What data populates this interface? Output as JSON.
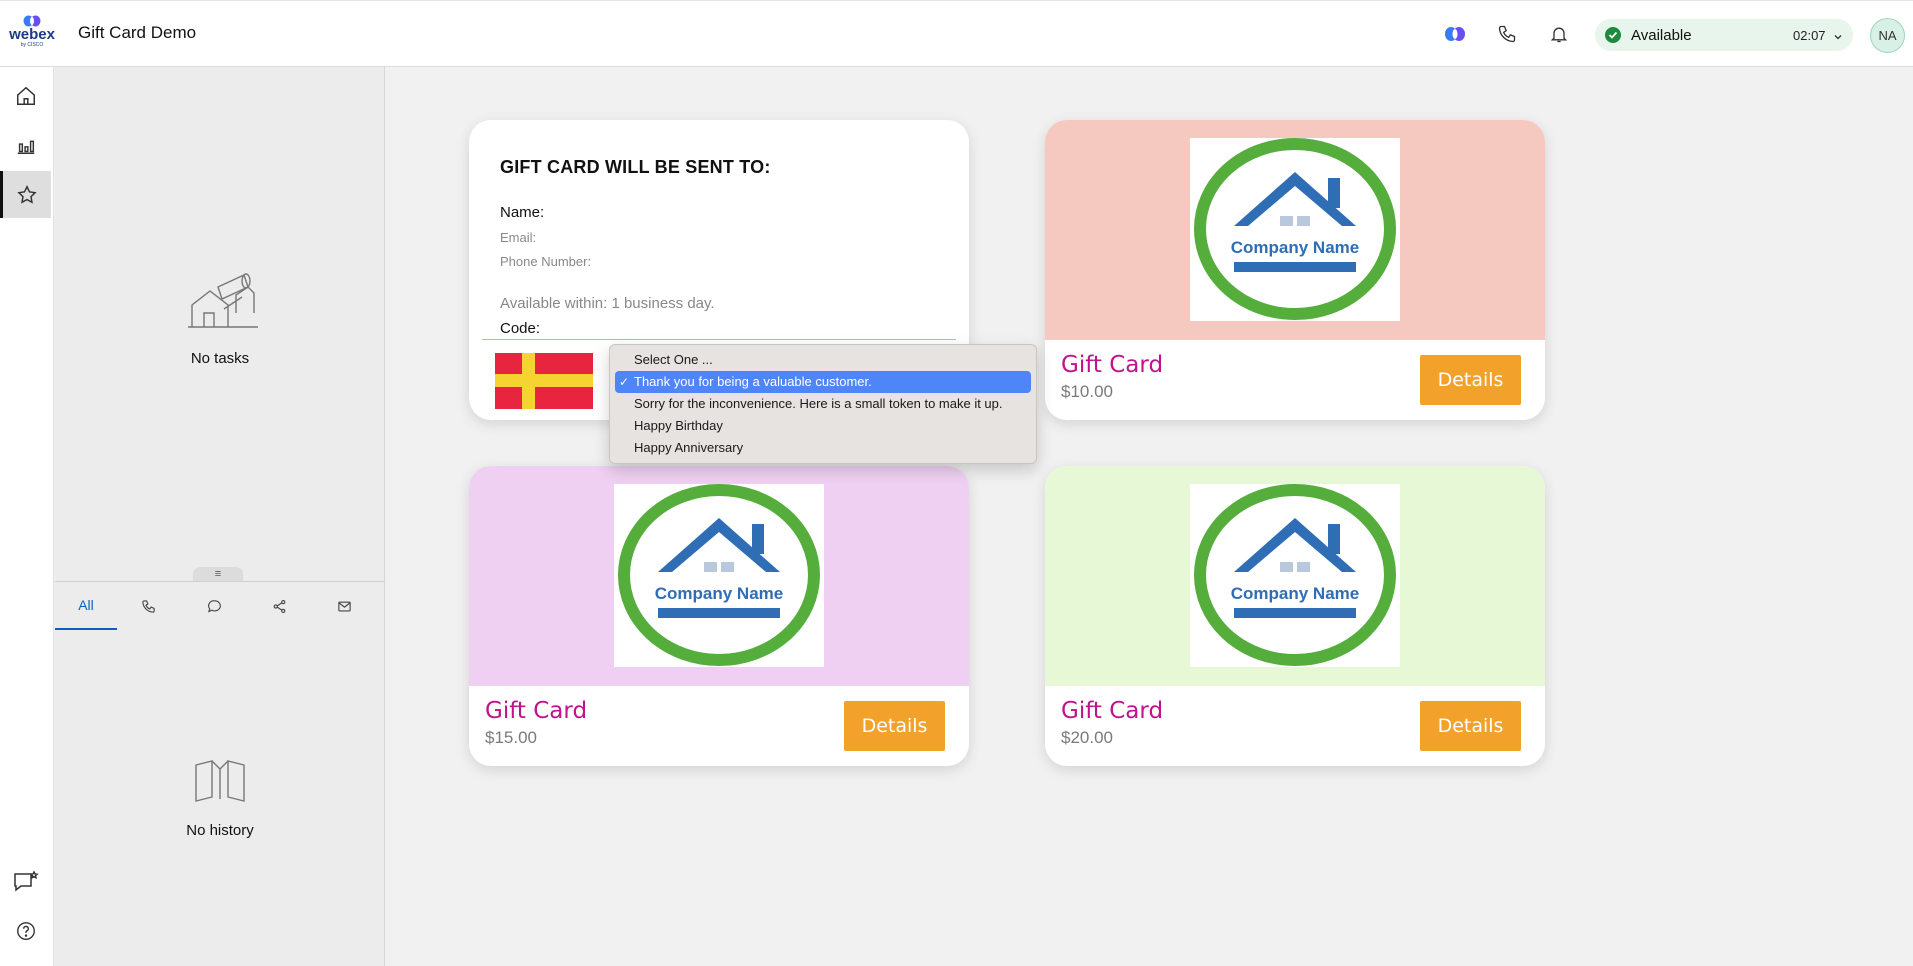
{
  "app": {
    "brand_word": "webex",
    "brand_sub": "by CISCO",
    "title": "Gift Card Demo"
  },
  "status": {
    "label": "Available",
    "timer": "02:07",
    "color": "#1e8a3d"
  },
  "user": {
    "initials": "NA"
  },
  "rail": {
    "items": [
      {
        "icon": "home-icon"
      },
      {
        "icon": "analytics-icon"
      },
      {
        "icon": "star-icon",
        "active": true
      },
      {
        "icon": "feedback-icon"
      },
      {
        "icon": "help-icon"
      }
    ]
  },
  "tasks": {
    "empty_text": "No tasks"
  },
  "history": {
    "tabs": [
      {
        "label": "All",
        "active": true
      },
      {
        "icon": "phone-icon"
      },
      {
        "icon": "chat-icon"
      },
      {
        "icon": "share-icon"
      },
      {
        "icon": "mail-icon"
      }
    ],
    "empty_text": "No history"
  },
  "form": {
    "heading": "GIFT CARD WILL BE SENT TO:",
    "name_label": "Name:",
    "email_label": "Email:",
    "phone_label": "Phone Number:",
    "availability": "Available within: 1 business day.",
    "code_label": "Code:"
  },
  "message_select": {
    "options": [
      "Select One ...",
      "Thank you for being a valuable customer.",
      "Sorry for the inconvenience. Here is a small token to make it up.",
      "Happy Birthday",
      "Happy Anniversary"
    ],
    "selected_index": 1
  },
  "cards": [
    {
      "title": "Gift Card",
      "price": "$10.00",
      "button": "Details",
      "bg": "#f5c9c0",
      "logo_text": "Company Name"
    },
    {
      "title": "Gift Card",
      "price": "$15.00",
      "button": "Details",
      "bg": "#efd0f2",
      "logo_text": "Company Name"
    },
    {
      "title": "Gift Card",
      "price": "$20.00",
      "button": "Details",
      "bg": "#e7f8d6",
      "logo_text": "Company Name"
    }
  ],
  "colors": {
    "accent_button": "#f2a22b",
    "card_title": "#c0128c",
    "logo_ring": "#55ad3c",
    "logo_blue": "#2f6db5"
  }
}
